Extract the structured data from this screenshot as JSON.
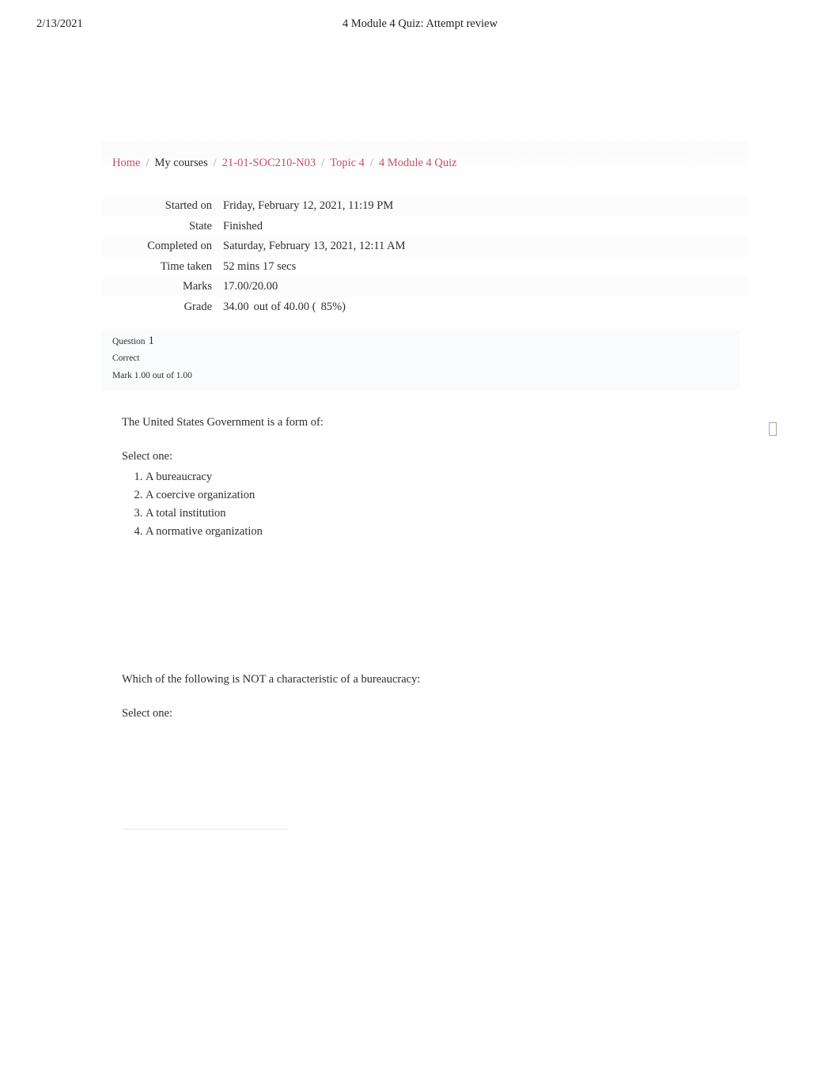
{
  "print_header": {
    "date": "2/13/2021",
    "title": "4 Module 4 Quiz: Attempt review"
  },
  "breadcrumb": {
    "items": [
      {
        "label": "Home",
        "type": "link"
      },
      {
        "label": "My courses",
        "type": "plain"
      },
      {
        "label": "21-01-SOC210-N03",
        "type": "link"
      },
      {
        "label": "Topic 4",
        "type": "link"
      },
      {
        "label": "4 Module 4 Quiz",
        "type": "link"
      }
    ],
    "separator": "/"
  },
  "attempt_summary": {
    "rows": [
      {
        "label": "Started on",
        "value": "Friday, February 12, 2021, 11:19 PM"
      },
      {
        "label": "State",
        "value": "Finished"
      },
      {
        "label": "Completed on",
        "value": "Saturday, February 13, 2021, 12:11 AM"
      },
      {
        "label": "Time taken",
        "value": "52 mins 17 secs"
      },
      {
        "label": "Marks",
        "value": "17.00/20.00"
      },
      {
        "label": "Grade",
        "value": "34.00"
      }
    ],
    "grade_detail": {
      "out_of": "out of 40.00 (",
      "percent": "85",
      "percent_suffix": "%)"
    }
  },
  "questions": [
    {
      "number_label": "Question",
      "number": "1",
      "state": "Correct",
      "mark": "Mark 1.00 out of 1.00",
      "text": "The United States Government is a form of:",
      "prompt": "Select one:",
      "answers": [
        "A bureaucracy",
        "A coercive organization",
        "A total institution",
        "A normative organization"
      ]
    },
    {
      "text": "Which of the following is NOT a characteristic of a bureaucracy:",
      "prompt": "Select one:"
    }
  ],
  "colors": {
    "link": "#c8505f",
    "text": "#2b2f33",
    "correct_marker_border": "#93b392",
    "info_panel_bg": "#fafbfc"
  }
}
